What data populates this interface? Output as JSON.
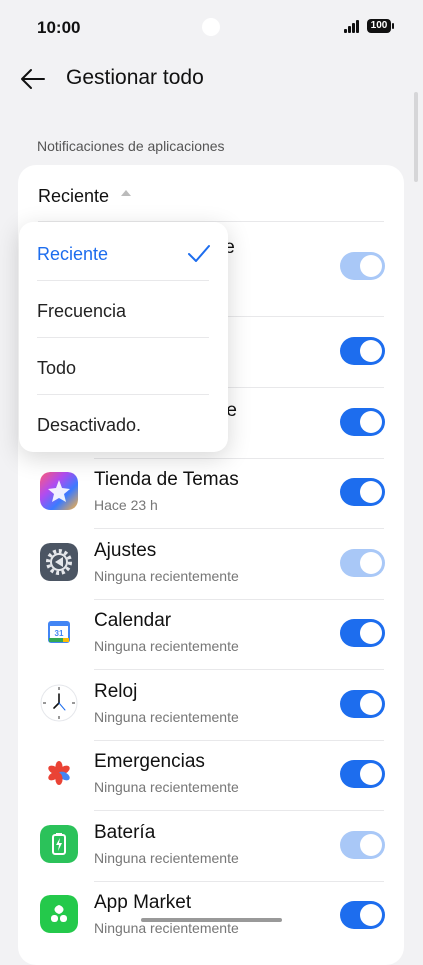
{
  "status_bar": {
    "time": "10:00",
    "battery": "100"
  },
  "header": {
    "title": "Gestionar todo"
  },
  "section": {
    "label": "Notificaciones de aplicaciones"
  },
  "sort": {
    "current": "Reciente"
  },
  "sort_menu": {
    "options": [
      "Reciente",
      "Frecuencia",
      "Todo",
      "Desactivado."
    ],
    "selected_index": 0
  },
  "hidden_rows": [
    {
      "name_fragment": "le",
      "toggle_on": true,
      "toggle_disabled": true
    },
    {
      "name_fragment": "",
      "toggle_on": true,
      "toggle_disabled": false
    },
    {
      "name_fragment": "re",
      "toggle_on": true,
      "toggle_disabled": false
    }
  ],
  "apps": [
    {
      "name": "Tienda de Temas",
      "sub": "Hace 23 h",
      "icon": "theme-store-icon",
      "toggle_disabled": false
    },
    {
      "name": "Ajustes",
      "sub": "Ninguna recientemente",
      "icon": "settings-gear-icon",
      "toggle_disabled": true
    },
    {
      "name": "Calendar",
      "sub": "Ninguna recientemente",
      "icon": "calendar-icon",
      "toggle_disabled": false
    },
    {
      "name": "Reloj",
      "sub": "Ninguna recientemente",
      "icon": "clock-icon",
      "toggle_disabled": false
    },
    {
      "name": "Emergencias",
      "sub": "Ninguna recientemente",
      "icon": "emergency-icon",
      "toggle_disabled": false
    },
    {
      "name": "Batería",
      "sub": "Ninguna recientemente",
      "icon": "battery-icon",
      "toggle_disabled": true
    },
    {
      "name": "App Market",
      "sub": "Ninguna recientemente",
      "icon": "app-market-icon",
      "toggle_disabled": false
    }
  ],
  "colors": {
    "accent": "#1d6dee",
    "accent_disabled": "#a9c8f7",
    "background": "#f2f2f4"
  }
}
